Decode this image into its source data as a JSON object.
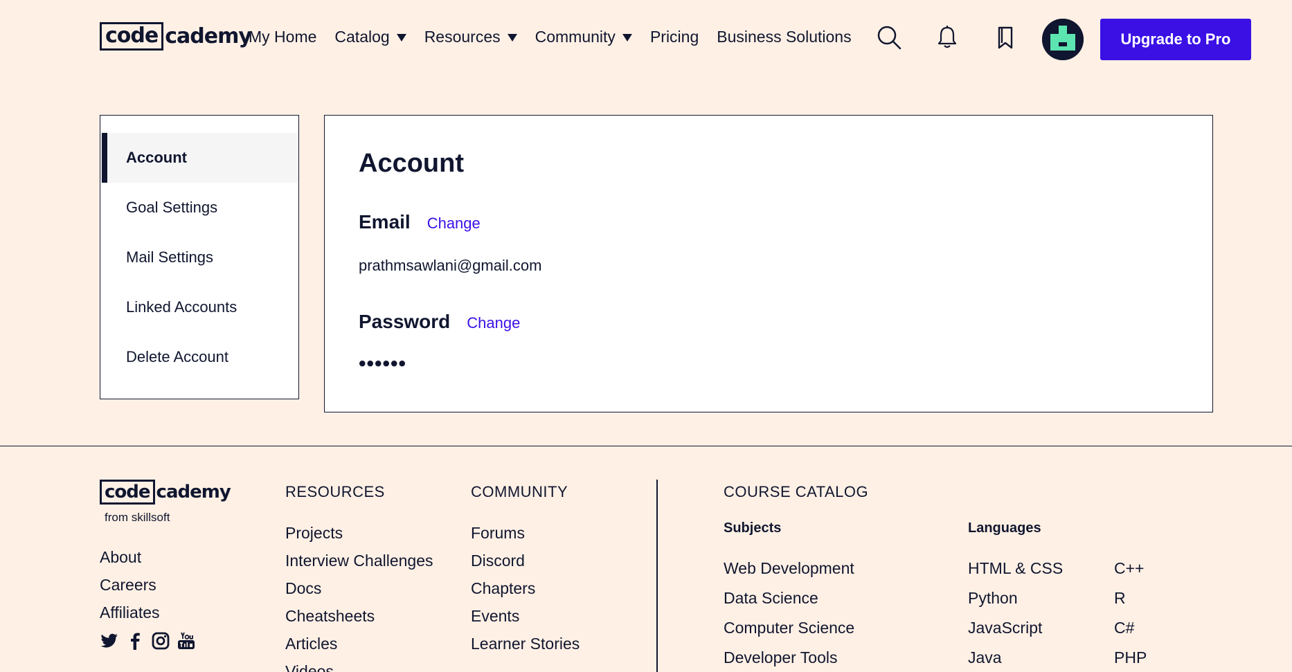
{
  "header": {
    "logo_boxed": "code",
    "logo_rest": "cademy",
    "nav": [
      {
        "label": "My Home",
        "dropdown": false
      },
      {
        "label": "Catalog",
        "dropdown": true
      },
      {
        "label": "Resources",
        "dropdown": true
      },
      {
        "label": "Community",
        "dropdown": true
      },
      {
        "label": "Pricing",
        "dropdown": false
      },
      {
        "label": "Business Solutions",
        "dropdown": false
      }
    ],
    "icons": [
      "search-icon",
      "bell-icon",
      "bookmark-icon"
    ],
    "upgrade_label": "Upgrade to Pro"
  },
  "sidebar": {
    "items": [
      {
        "label": "Account",
        "active": true
      },
      {
        "label": "Goal Settings",
        "active": false
      },
      {
        "label": "Mail Settings",
        "active": false
      },
      {
        "label": "Linked Accounts",
        "active": false
      },
      {
        "label": "Delete Account",
        "active": false
      }
    ]
  },
  "account": {
    "title": "Account",
    "email_label": "Email",
    "email_change": "Change",
    "email_value": "prathmsawlani@gmail.com",
    "password_label": "Password",
    "password_change": "Change",
    "password_value": "••••••"
  },
  "footer": {
    "logo_boxed": "code",
    "logo_rest": "cademy",
    "from": "from skillsoft",
    "about_links": [
      "About",
      "Careers",
      "Affiliates"
    ],
    "social_icons": [
      "twitter-icon",
      "facebook-icon",
      "instagram-icon",
      "youtube-icon"
    ],
    "resources": {
      "heading": "RESOURCES",
      "links": [
        "Projects",
        "Interview Challenges",
        "Docs",
        "Cheatsheets",
        "Articles",
        "Videos"
      ]
    },
    "community": {
      "heading": "COMMUNITY",
      "links": [
        "Forums",
        "Discord",
        "Chapters",
        "Events",
        "Learner Stories"
      ]
    },
    "catalog": {
      "heading": "COURSE CATALOG",
      "subjects_heading": "Subjects",
      "subjects": [
        "Web Development",
        "Data Science",
        "Computer Science",
        "Developer Tools"
      ],
      "languages_heading": "Languages",
      "languages_col1": [
        "HTML & CSS",
        "Python",
        "JavaScript",
        "Java"
      ],
      "languages_col2": [
        "C++",
        "R",
        "C#",
        "PHP"
      ]
    }
  },
  "colors": {
    "background": "#fff0e5",
    "ink": "#10162f",
    "accent": "#3a10e5",
    "avatar_accent": "#5ce5b0"
  }
}
